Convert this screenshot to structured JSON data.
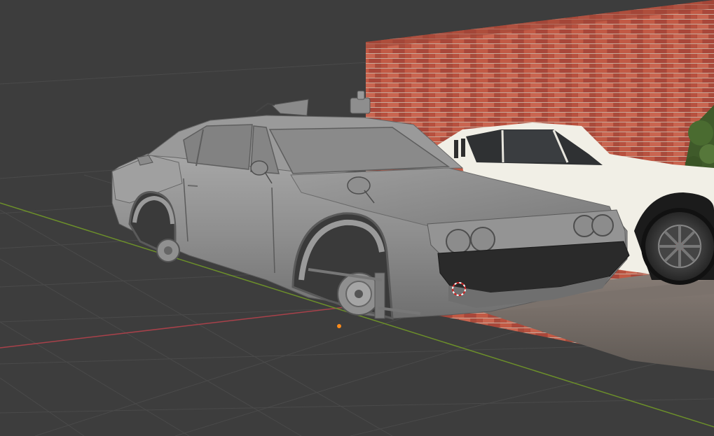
{
  "viewport": {
    "background": "#3d3d3d",
    "grid_color": "#4a4a4a",
    "x_axis_color": "#a8414a",
    "y_axis_color": "#6c8f2a",
    "origin_marker_color": "#ff8c1a",
    "cursor_color": "#cc2222"
  },
  "scene": {
    "objects": [
      "car-model-grey",
      "reference-image-plane"
    ],
    "reference_image": {
      "subjects": [
        "brick-wall",
        "white-classic-car",
        "tree"
      ]
    }
  }
}
